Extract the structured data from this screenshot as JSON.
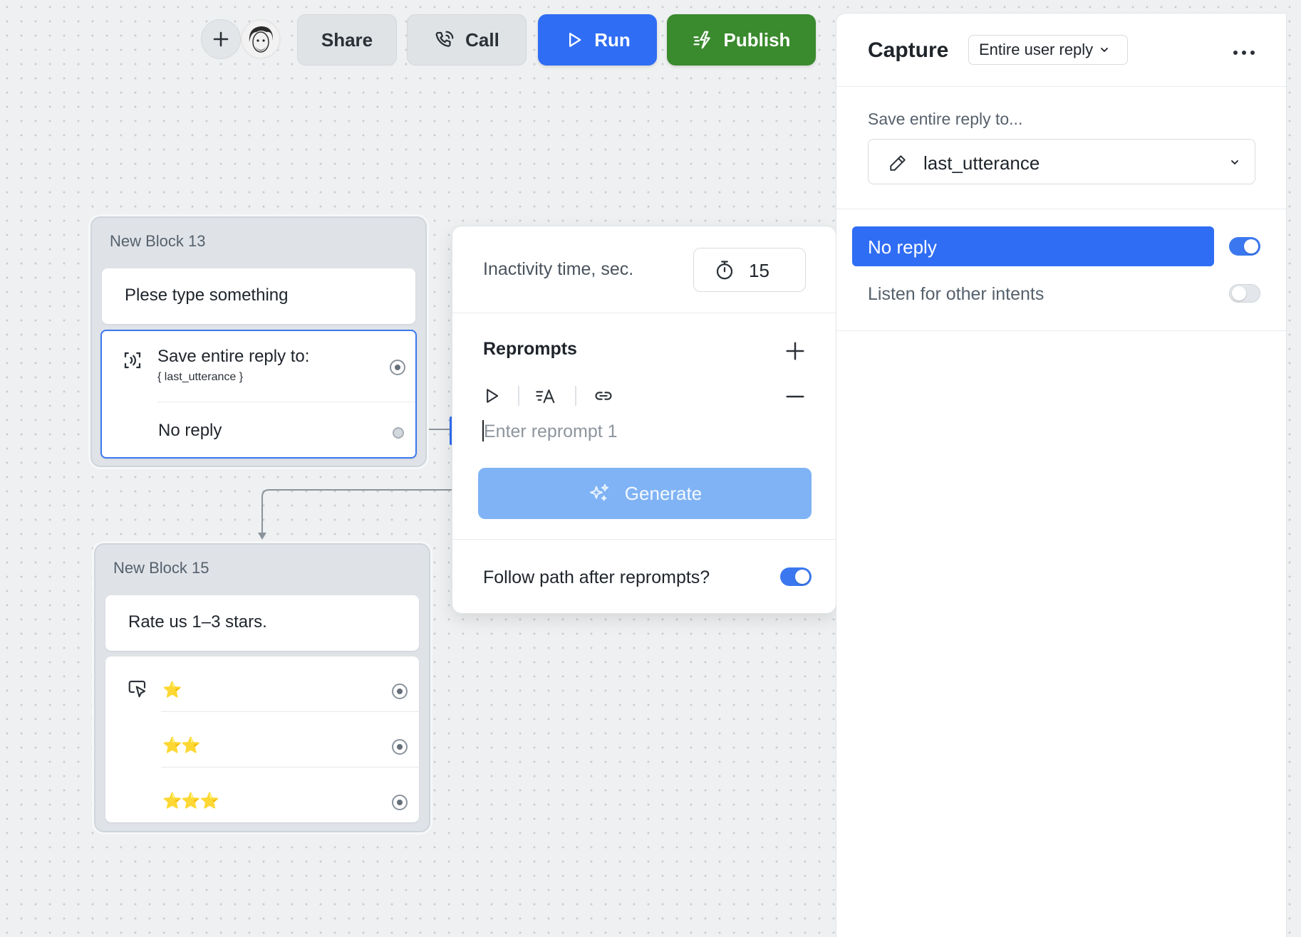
{
  "toolbar": {
    "share_label": "Share",
    "call_label": "Call",
    "run_label": "Run",
    "publish_label": "Publish"
  },
  "blocks": [
    {
      "title": "New Block 13",
      "message": "Plese type something",
      "capture_label": "Save entire reply to:",
      "capture_variable": "{ last_utterance }",
      "no_reply_label": "No reply"
    },
    {
      "title": "New Block 15",
      "message": "Rate us 1–3 stars.",
      "choices": [
        "⭐",
        "⭐⭐",
        "⭐⭐⭐"
      ]
    }
  ],
  "popup": {
    "inactivity_label": "Inactivity time, sec.",
    "inactivity_value": "15",
    "reprompts_label": "Reprompts",
    "reprompt_placeholder": "Enter reprompt 1",
    "generate_label": "Generate",
    "follow_path_label": "Follow path after reprompts?",
    "follow_path_enabled": true
  },
  "panel": {
    "title": "Capture",
    "capture_mode": "Entire user reply",
    "save_to_label": "Save entire reply to...",
    "variable": "last_utterance",
    "no_reply_label": "No reply",
    "no_reply_enabled": true,
    "listen_label": "Listen for other intents",
    "listen_enabled": false
  },
  "colors": {
    "run": "#2f6df4",
    "publish": "#3a8a2e",
    "accent": "#3b78f0",
    "generate": "#7fb3f5"
  }
}
